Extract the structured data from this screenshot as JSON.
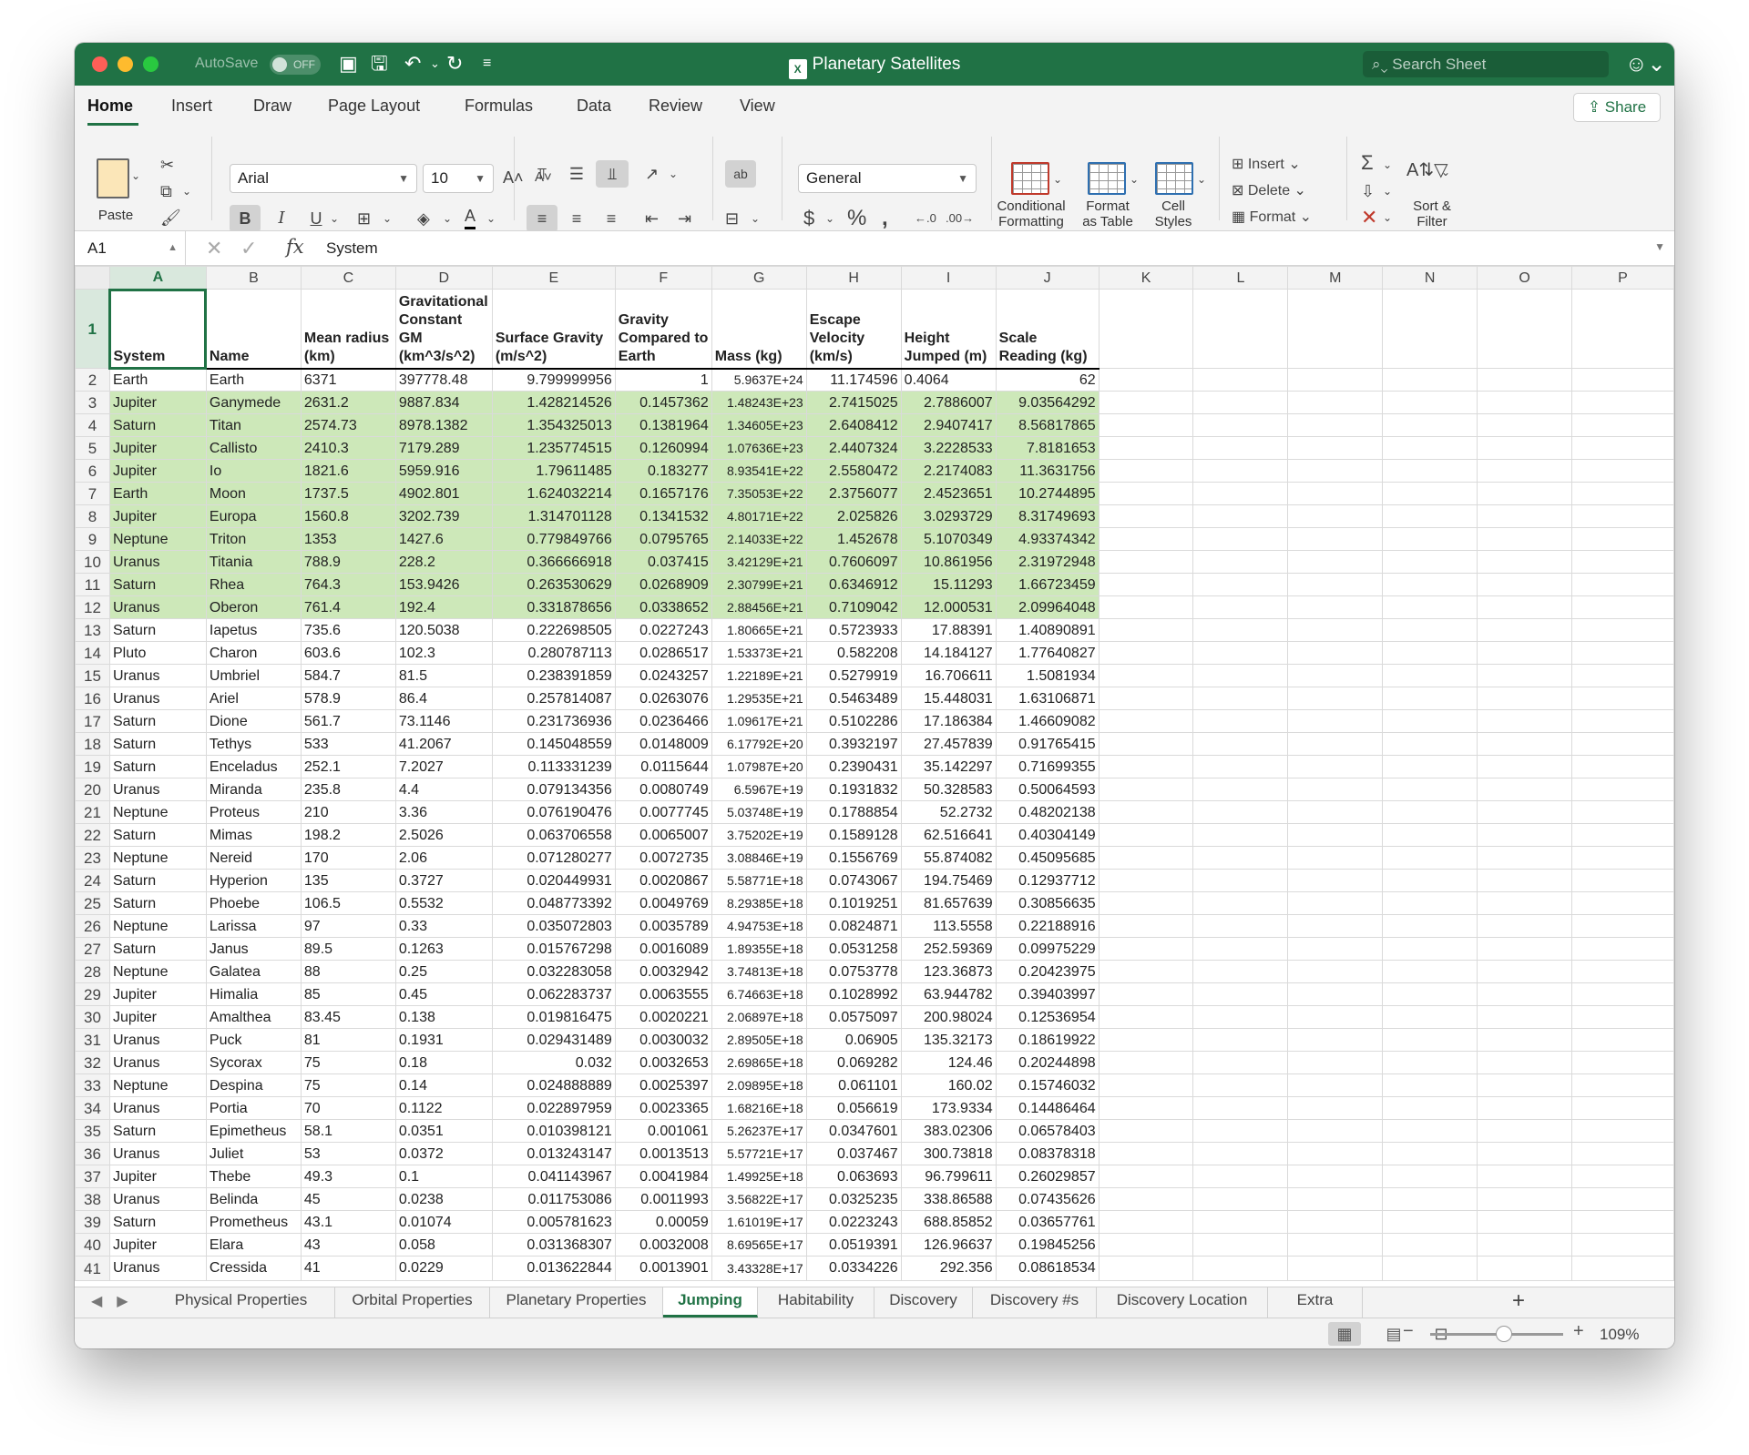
{
  "window": {
    "title": "Planetary Satellites",
    "autosave_label": "AutoSave",
    "autosave_state": "OFF",
    "search_placeholder": "Search Sheet"
  },
  "ribbon": {
    "tabs": [
      "Home",
      "Insert",
      "Draw",
      "Page Layout",
      "Formulas",
      "Data",
      "Review",
      "View"
    ],
    "share_label": "Share",
    "paste_label": "Paste",
    "font_name": "Arial",
    "font_size": "10",
    "number_format": "General",
    "conditional_formatting_label": [
      "Conditional",
      "Formatting"
    ],
    "format_as_table_label": [
      "Format",
      "as Table"
    ],
    "cell_styles_label": [
      "Cell",
      "Styles"
    ],
    "insert_label": "Insert",
    "delete_label": "Delete",
    "format_label": "Format",
    "sort_filter_label": [
      "Sort &",
      "Filter"
    ]
  },
  "formula_bar": {
    "cell_ref": "A1",
    "content": "System"
  },
  "grid": {
    "columns": [
      "A",
      "B",
      "C",
      "D",
      "E",
      "F",
      "G",
      "H",
      "I",
      "J",
      "K",
      "L",
      "M",
      "N",
      "O",
      "P"
    ],
    "headers": [
      "System",
      "Name",
      "Mean radius (km)",
      "Gravitational Constant GM (km^3/s^2)",
      "Surface Gravity (m/s^2)",
      "Gravity Compared to Earth",
      "Mass (kg)",
      "Escape Velocity (km/s)",
      "Height Jumped (m)",
      "Scale Reading (kg)"
    ],
    "rows": [
      [
        "Earth",
        "Earth",
        "6371",
        "397778.48",
        "9.799999956",
        "1",
        "5.9637E+24",
        "11.174596",
        "0.4064",
        "62"
      ],
      [
        "Jupiter",
        "Ganymede",
        "2631.2",
        "9887.834",
        "1.428214526",
        "0.1457362",
        "1.48243E+23",
        "2.7415025",
        "2.7886007",
        "9.03564292"
      ],
      [
        "Saturn",
        "Titan",
        "2574.73",
        "8978.1382",
        "1.354325013",
        "0.1381964",
        "1.34605E+23",
        "2.6408412",
        "2.9407417",
        "8.56817865"
      ],
      [
        "Jupiter",
        "Callisto",
        "2410.3",
        "7179.289",
        "1.235774515",
        "0.1260994",
        "1.07636E+23",
        "2.4407324",
        "3.2228533",
        "7.8181653"
      ],
      [
        "Jupiter",
        "Io",
        "1821.6",
        "5959.916",
        "1.79611485",
        "0.183277",
        "8.93541E+22",
        "2.5580472",
        "2.2174083",
        "11.3631756"
      ],
      [
        "Earth",
        "Moon",
        "1737.5",
        "4902.801",
        "1.624032214",
        "0.1657176",
        "7.35053E+22",
        "2.3756077",
        "2.4523651",
        "10.2744895"
      ],
      [
        "Jupiter",
        "Europa",
        "1560.8",
        "3202.739",
        "1.314701128",
        "0.1341532",
        "4.80171E+22",
        "2.025826",
        "3.0293729",
        "8.31749693"
      ],
      [
        "Neptune",
        "Triton",
        "1353",
        "1427.6",
        "0.779849766",
        "0.0795765",
        "2.14033E+22",
        "1.452678",
        "5.1070349",
        "4.93374342"
      ],
      [
        "Uranus",
        "Titania",
        "788.9",
        "228.2",
        "0.366666918",
        "0.037415",
        "3.42129E+21",
        "0.7606097",
        "10.861956",
        "2.31972948"
      ],
      [
        "Saturn",
        "Rhea",
        "764.3",
        "153.9426",
        "0.263530629",
        "0.0268909",
        "2.30799E+21",
        "0.6346912",
        "15.11293",
        "1.66723459"
      ],
      [
        "Uranus",
        "Oberon",
        "761.4",
        "192.4",
        "0.331878656",
        "0.0338652",
        "2.88456E+21",
        "0.7109042",
        "12.000531",
        "2.09964048"
      ],
      [
        "Saturn",
        "Iapetus",
        "735.6",
        "120.5038",
        "0.222698505",
        "0.0227243",
        "1.80665E+21",
        "0.5723933",
        "17.88391",
        "1.40890891"
      ],
      [
        "Pluto",
        "Charon",
        "603.6",
        "102.3",
        "0.280787113",
        "0.0286517",
        "1.53373E+21",
        "0.582208",
        "14.184127",
        "1.77640827"
      ],
      [
        "Uranus",
        "Umbriel",
        "584.7",
        "81.5",
        "0.238391859",
        "0.0243257",
        "1.22189E+21",
        "0.5279919",
        "16.706611",
        "1.5081934"
      ],
      [
        "Uranus",
        "Ariel",
        "578.9",
        "86.4",
        "0.257814087",
        "0.0263076",
        "1.29535E+21",
        "0.5463489",
        "15.448031",
        "1.63106871"
      ],
      [
        "Saturn",
        "Dione",
        "561.7",
        "73.1146",
        "0.231736936",
        "0.0236466",
        "1.09617E+21",
        "0.5102286",
        "17.186384",
        "1.46609082"
      ],
      [
        "Saturn",
        "Tethys",
        "533",
        "41.2067",
        "0.145048559",
        "0.0148009",
        "6.17792E+20",
        "0.3932197",
        "27.457839",
        "0.91765415"
      ],
      [
        "Saturn",
        "Enceladus",
        "252.1",
        "7.2027",
        "0.113331239",
        "0.0115644",
        "1.07987E+20",
        "0.2390431",
        "35.142297",
        "0.71699355"
      ],
      [
        "Uranus",
        "Miranda",
        "235.8",
        "4.4",
        "0.079134356",
        "0.0080749",
        "6.5967E+19",
        "0.1931832",
        "50.328583",
        "0.50064593"
      ],
      [
        "Neptune",
        "Proteus",
        "210",
        "3.36",
        "0.076190476",
        "0.0077745",
        "5.03748E+19",
        "0.1788854",
        "52.2732",
        "0.48202138"
      ],
      [
        "Saturn",
        "Mimas",
        "198.2",
        "2.5026",
        "0.063706558",
        "0.0065007",
        "3.75202E+19",
        "0.1589128",
        "62.516641",
        "0.40304149"
      ],
      [
        "Neptune",
        "Nereid",
        "170",
        "2.06",
        "0.071280277",
        "0.0072735",
        "3.08846E+19",
        "0.1556769",
        "55.874082",
        "0.45095685"
      ],
      [
        "Saturn",
        "Hyperion",
        "135",
        "0.3727",
        "0.020449931",
        "0.0020867",
        "5.58771E+18",
        "0.0743067",
        "194.75469",
        "0.12937712"
      ],
      [
        "Saturn",
        "Phoebe",
        "106.5",
        "0.5532",
        "0.048773392",
        "0.0049769",
        "8.29385E+18",
        "0.1019251",
        "81.657639",
        "0.30856635"
      ],
      [
        "Neptune",
        "Larissa",
        "97",
        "0.33",
        "0.035072803",
        "0.0035789",
        "4.94753E+18",
        "0.0824871",
        "113.5558",
        "0.22188916"
      ],
      [
        "Saturn",
        "Janus",
        "89.5",
        "0.1263",
        "0.015767298",
        "0.0016089",
        "1.89355E+18",
        "0.0531258",
        "252.59369",
        "0.09975229"
      ],
      [
        "Neptune",
        "Galatea",
        "88",
        "0.25",
        "0.032283058",
        "0.0032942",
        "3.74813E+18",
        "0.0753778",
        "123.36873",
        "0.20423975"
      ],
      [
        "Jupiter",
        "Himalia",
        "85",
        "0.45",
        "0.062283737",
        "0.0063555",
        "6.74663E+18",
        "0.1028992",
        "63.944782",
        "0.39403997"
      ],
      [
        "Jupiter",
        "Amalthea",
        "83.45",
        "0.138",
        "0.019816475",
        "0.0020221",
        "2.06897E+18",
        "0.0575097",
        "200.98024",
        "0.12536954"
      ],
      [
        "Uranus",
        "Puck",
        "81",
        "0.1931",
        "0.029431489",
        "0.0030032",
        "2.89505E+18",
        "0.06905",
        "135.32173",
        "0.18619922"
      ],
      [
        "Uranus",
        "Sycorax",
        "75",
        "0.18",
        "0.032",
        "0.0032653",
        "2.69865E+18",
        "0.069282",
        "124.46",
        "0.20244898"
      ],
      [
        "Neptune",
        "Despina",
        "75",
        "0.14",
        "0.024888889",
        "0.0025397",
        "2.09895E+18",
        "0.061101",
        "160.02",
        "0.15746032"
      ],
      [
        "Uranus",
        "Portia",
        "70",
        "0.1122",
        "0.022897959",
        "0.0023365",
        "1.68216E+18",
        "0.056619",
        "173.9334",
        "0.14486464"
      ],
      [
        "Saturn",
        "Epimetheus",
        "58.1",
        "0.0351",
        "0.010398121",
        "0.001061",
        "5.26237E+17",
        "0.0347601",
        "383.02306",
        "0.06578403"
      ],
      [
        "Uranus",
        "Juliet",
        "53",
        "0.0372",
        "0.013243147",
        "0.0013513",
        "5.57721E+17",
        "0.037467",
        "300.73818",
        "0.08378318"
      ],
      [
        "Jupiter",
        "Thebe",
        "49.3",
        "0.1",
        "0.041143967",
        "0.0041984",
        "1.49925E+18",
        "0.063693",
        "96.799611",
        "0.26029857"
      ],
      [
        "Uranus",
        "Belinda",
        "45",
        "0.0238",
        "0.011753086",
        "0.0011993",
        "3.56822E+17",
        "0.0325235",
        "338.86588",
        "0.07435626"
      ],
      [
        "Saturn",
        "Prometheus",
        "43.1",
        "0.01074",
        "0.005781623",
        "0.00059",
        "1.61019E+17",
        "0.0223243",
        "688.85852",
        "0.03657761"
      ],
      [
        "Jupiter",
        "Elara",
        "43",
        "0.058",
        "0.031368307",
        "0.0032008",
        "8.69565E+17",
        "0.0519391",
        "126.96637",
        "0.19845256"
      ],
      [
        "Uranus",
        "Cressida",
        "41",
        "0.0229",
        "0.013622844",
        "0.0013901",
        "3.43328E+17",
        "0.0334226",
        "292.356",
        "0.08618534"
      ]
    ]
  },
  "sheet_tabs": [
    "Physical Properties",
    "Orbital Properties",
    "Planetary Properties",
    "Jumping",
    "Habitability",
    "Discovery",
    "Discovery #s",
    "Discovery Location",
    "Extra"
  ],
  "active_sheet": "Jumping",
  "status": {
    "zoom": "109%"
  },
  "colors": {
    "excel_green": "#207245",
    "highlight": "#cde8b9"
  }
}
